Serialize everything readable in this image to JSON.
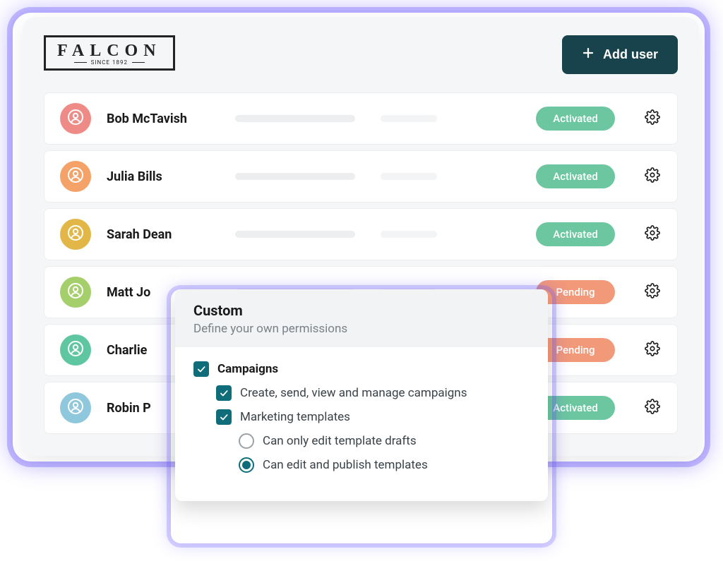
{
  "brand": {
    "name": "FALCON",
    "tagline": "SINCE 1892"
  },
  "header": {
    "add_user_label": "Add user"
  },
  "colors": {
    "accent_dark": "#19434c",
    "checkbox": "#0f6d7a",
    "glow": "#6c5aff",
    "status_activated": "#6cc7a0",
    "status_pending": "#f2997a"
  },
  "status_labels": {
    "activated": "Activated",
    "pending": "Pending"
  },
  "users": [
    {
      "name": "Bob McTavish",
      "status": "activated",
      "avatar_color": "#ef8b86"
    },
    {
      "name": "Julia Bills",
      "status": "activated",
      "avatar_color": "#f4a268"
    },
    {
      "name": "Sarah Dean",
      "status": "activated",
      "avatar_color": "#e2b747"
    },
    {
      "name": "Matt Jo",
      "status": "pending",
      "avatar_color": "#a4cf6a"
    },
    {
      "name": "Charlie",
      "status": "pending",
      "avatar_color": "#5ec6a0"
    },
    {
      "name": "Robin P",
      "status": "activated",
      "avatar_color": "#8fc8dd"
    }
  ],
  "popover": {
    "title": "Custom",
    "subtitle": "Define your own permissions",
    "permissions": {
      "campaigns": {
        "label": "Campaigns",
        "checked": true,
        "children": [
          {
            "key": "create_send",
            "label": "Create, send, view and manage campaigns",
            "checked": true
          },
          {
            "key": "marketing_templates",
            "label": "Marketing templates",
            "checked": true,
            "options": [
              {
                "key": "edit_drafts",
                "label": "Can only edit template drafts",
                "selected": false
              },
              {
                "key": "edit_publish",
                "label": "Can edit and publish templates",
                "selected": true
              }
            ]
          }
        ]
      }
    }
  }
}
